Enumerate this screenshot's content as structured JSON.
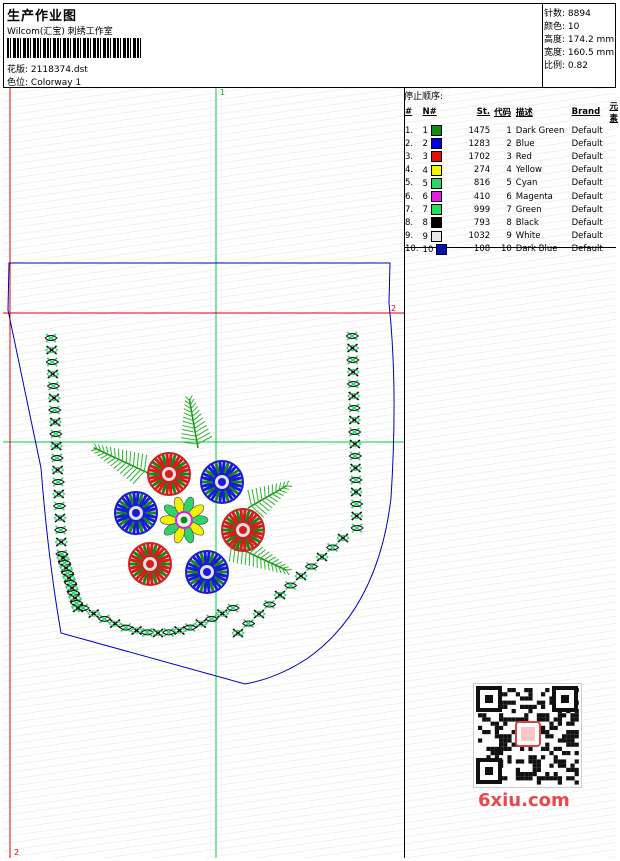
{
  "header": {
    "title": "生产作业图",
    "company": "Wilcom(汇宝) 刺绣工作室",
    "design_label": "花版:",
    "design_value": "2118374.dst",
    "colorway_label": "色位:",
    "colorway_value": "Colorway 1"
  },
  "stats": [
    {
      "label": "针数",
      "value": "8894"
    },
    {
      "label": "颜色",
      "value": "10"
    },
    {
      "label": "高度",
      "value": "174.2 mm"
    },
    {
      "label": "宽度",
      "value": "160.5 mm"
    },
    {
      "label": "比例",
      "value": "0.82"
    }
  ],
  "stop_sequence": {
    "title": "停止顺序:",
    "columns": [
      "#",
      "N#",
      "St.",
      "代码",
      "描述",
      "Brand",
      "元素"
    ],
    "rows": [
      {
        "idx": "1.",
        "n": "1",
        "color": "#138a13",
        "st": "1475",
        "code": "1",
        "desc": "Dark Green",
        "brand": "Default"
      },
      {
        "idx": "2.",
        "n": "2",
        "color": "#0000e0",
        "st": "1283",
        "code": "2",
        "desc": "Blue",
        "brand": "Default"
      },
      {
        "idx": "3.",
        "n": "3",
        "color": "#e01010",
        "st": "1702",
        "code": "3",
        "desc": "Red",
        "brand": "Default"
      },
      {
        "idx": "4.",
        "n": "4",
        "color": "#f5f500",
        "st": "274",
        "code": "4",
        "desc": "Yellow",
        "brand": "Default"
      },
      {
        "idx": "5.",
        "n": "5",
        "color": "#2fd36a",
        "st": "816",
        "code": "5",
        "desc": "Cyan",
        "brand": "Default"
      },
      {
        "idx": "6.",
        "n": "6",
        "color": "#e020e0",
        "st": "410",
        "code": "6",
        "desc": "Magenta",
        "brand": "Default"
      },
      {
        "idx": "7.",
        "n": "7",
        "color": "#20e060",
        "st": "999",
        "code": "7",
        "desc": "Green",
        "brand": "Default"
      },
      {
        "idx": "8.",
        "n": "8",
        "color": "#000000",
        "st": "793",
        "code": "8",
        "desc": "Black",
        "brand": "Default"
      },
      {
        "idx": "9.",
        "n": "9",
        "color": "#e8e8e8",
        "st": "1032",
        "code": "9",
        "desc": "White",
        "brand": "Default"
      },
      {
        "idx": "10.",
        "n": "10",
        "color": "#0010c0",
        "st": "108",
        "code": "10",
        "desc": "Dark Blue",
        "brand": "Default"
      }
    ]
  },
  "canvas": {
    "axis_label_top": "1",
    "axis_label_right": "2",
    "axis_label_bottom": "2"
  },
  "watermark": {
    "logo_text": "6xiu.com",
    "qr_label": "qr-code"
  },
  "colors": {
    "outline": "#0000c0",
    "guide_green": "#00cc44",
    "guide_red": "#e00000",
    "flower_red": "#d21e1e",
    "flower_blue": "#1a1ad8",
    "leaf_green": "#2db52d",
    "petal_yellow": "#f2f200",
    "petal_cyan": "#2fd36a"
  }
}
